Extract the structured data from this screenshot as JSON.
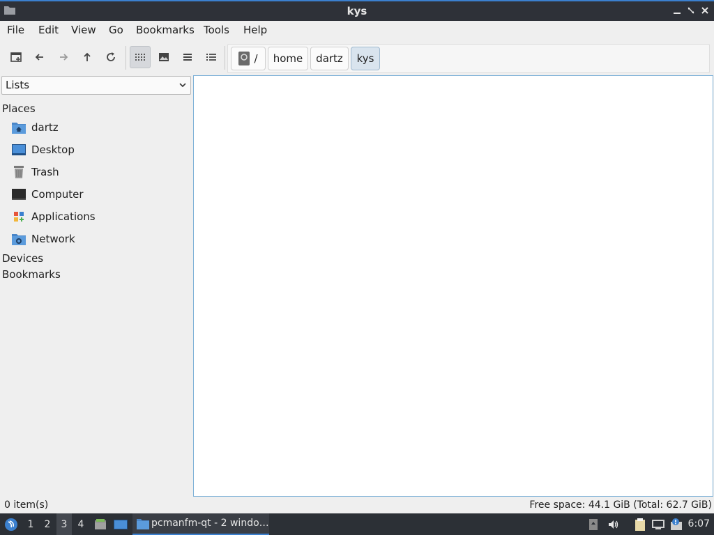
{
  "window": {
    "title": "kys",
    "icon": "folder-icon",
    "controls": [
      "minimize-icon",
      "restore-icon",
      "close-icon"
    ]
  },
  "menubar": {
    "items": [
      "File",
      "Edit",
      "View",
      "Go",
      "Bookmarks",
      "Tools",
      "Help"
    ]
  },
  "toolbar": {
    "buttons": [
      "new-tab-icon",
      "back-icon",
      "forward-icon",
      "up-icon",
      "reload-icon",
      "icon-view-icon",
      "thumbnail-view-icon",
      "compact-view-icon",
      "detailed-list-icon"
    ],
    "active_view": "icon-view"
  },
  "breadcrumb": {
    "root": "/",
    "items": [
      "home",
      "dartz",
      "kys"
    ],
    "current": "kys"
  },
  "sidepane": {
    "mode": "Lists",
    "sections": {
      "places": "Places",
      "devices": "Devices",
      "bookmarks": "Bookmarks"
    },
    "places": [
      {
        "label": "dartz",
        "icon": "home-folder-icon"
      },
      {
        "label": "Desktop",
        "icon": "desktop-icon"
      },
      {
        "label": "Trash",
        "icon": "trash-icon"
      },
      {
        "label": "Computer",
        "icon": "computer-icon"
      },
      {
        "label": "Applications",
        "icon": "applications-icon"
      },
      {
        "label": "Network",
        "icon": "network-folder-icon"
      }
    ]
  },
  "statusbar": {
    "items": "0 item(s)",
    "free_space": "Free space: 44.1 GiB (Total: 62.7 GiB)"
  },
  "taskbar": {
    "workspaces": [
      "1",
      "2",
      "3",
      "4"
    ],
    "active_workspace": "3",
    "task_label": "pcmanfm-qt - 2 windo…",
    "clock": "6:07",
    "tray": [
      "storage-icon",
      "volume-icon",
      "clipboard-icon",
      "network-icon",
      "notification-icon"
    ]
  },
  "colors": {
    "accent": "#3b80cf",
    "titlebar": "#2e3138",
    "taskbar": "#2c3036",
    "selection_border": "#7fb2d8"
  }
}
